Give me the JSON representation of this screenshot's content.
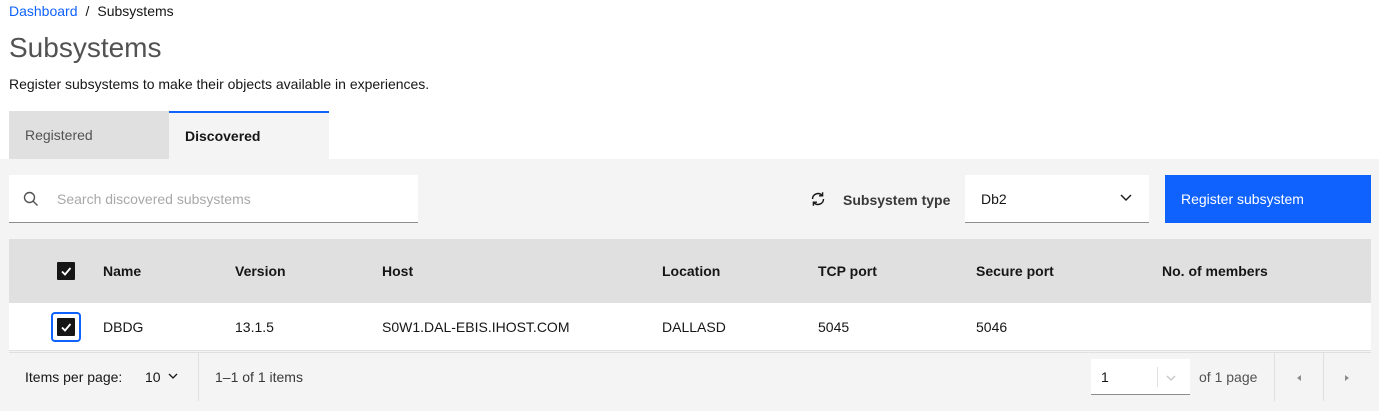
{
  "breadcrumb": {
    "home": "Dashboard",
    "separator": "/",
    "current": "Subsystems"
  },
  "page": {
    "title": "Subsystems",
    "description": "Register subsystems to make their objects available in experiences."
  },
  "tabs": [
    {
      "label": "Registered",
      "active": false
    },
    {
      "label": "Discovered",
      "active": true
    }
  ],
  "toolbar": {
    "search_placeholder": "Search discovered subsystems",
    "search_value": "",
    "subsystem_type_label": "Subsystem type",
    "subsystem_type_value": "Db2",
    "register_button": "Register subsystem"
  },
  "table": {
    "headers": [
      "Name",
      "Version",
      "Host",
      "Location",
      "TCP port",
      "Secure port",
      "No. of members"
    ],
    "rows": [
      {
        "selected": true,
        "name": "DBDG",
        "version": "13.1.5",
        "host": "S0W1.DAL-EBIS.IHOST.COM",
        "location": "DALLASD",
        "tcp_port": "5045",
        "secure_port": "5046",
        "members": ""
      }
    ]
  },
  "pagination": {
    "items_per_page_label": "Items per page:",
    "items_per_page_value": "10",
    "range_text": "1–1 of 1 items",
    "page_value": "1",
    "of_pages_text": "of 1 page"
  },
  "colors": {
    "accent": "#0f62fe",
    "tab_inactive": "#e0e0e0",
    "panel_bg": "#f4f4f4"
  },
  "icons": [
    "search-icon",
    "refresh-icon",
    "chevron-down-icon",
    "checkmark-icon",
    "caret-left-icon",
    "caret-right-icon"
  ]
}
